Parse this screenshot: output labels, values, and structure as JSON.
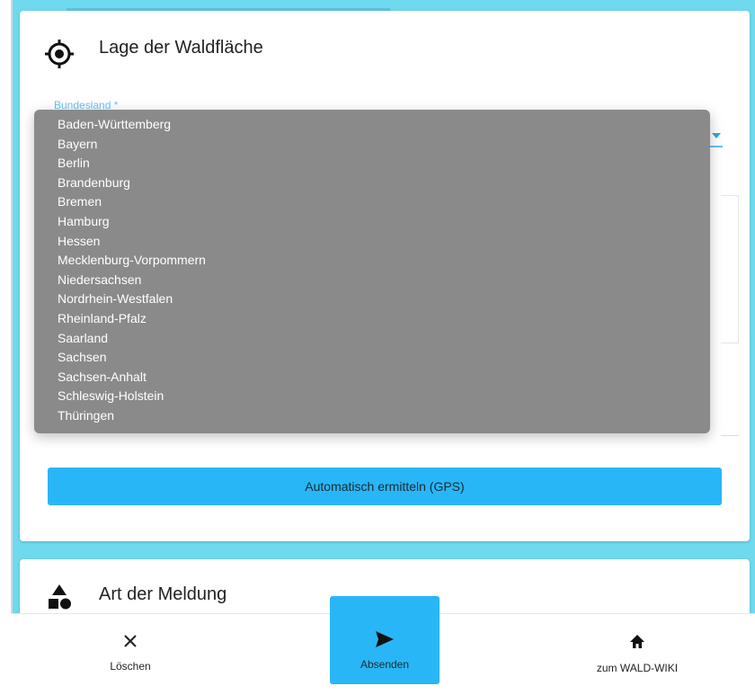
{
  "section_location": {
    "title": "Lage der Waldfläche",
    "state_field_label": "Bundesland *",
    "gps_button_label": "Automatisch ermitteln (GPS)"
  },
  "state_dropdown": {
    "options": [
      "Baden-Württemberg",
      "Bayern",
      "Berlin",
      "Brandenburg",
      "Bremen",
      "Hamburg",
      "Hessen",
      "Mecklenburg-Vorpommern",
      "Niedersachsen",
      "Nordrhein-Westfalen",
      "Rheinland-Pfalz",
      "Saarland",
      "Sachsen",
      "Sachsen-Anhalt",
      "Schleswig-Holstein",
      "Thüringen"
    ]
  },
  "section_report_type": {
    "title": "Art der Meldung"
  },
  "bottom_nav": {
    "delete_label": "Löschen",
    "send_label": "Absenden",
    "wiki_label": "zum WALD-WIKI"
  },
  "colors": {
    "accent": "#29b6f6",
    "page_background": "#6fd9ee",
    "dropdown_background": "#8a8a8a"
  },
  "icons": {
    "location": "crosshair-location-icon",
    "report_type": "shapes-icon",
    "delete": "close-icon",
    "send": "send-icon",
    "wiki": "home-icon",
    "select_arrow": "chevron-down-icon"
  }
}
